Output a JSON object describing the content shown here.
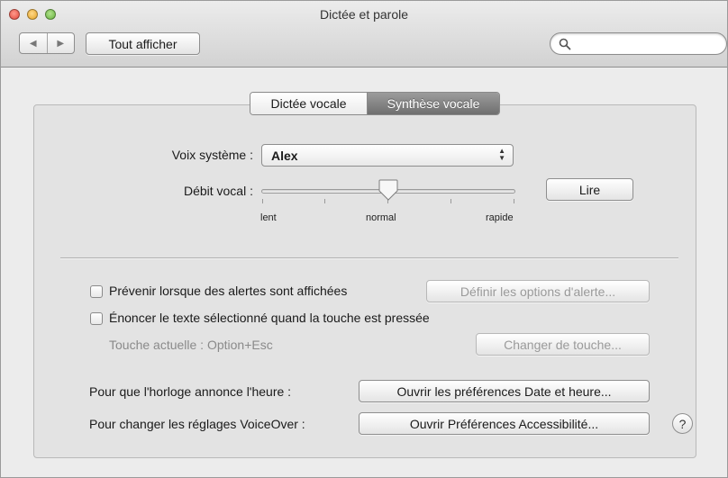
{
  "window": {
    "title": "Dictée et parole"
  },
  "toolbar": {
    "back_icon": "◀",
    "forward_icon": "▶",
    "show_all_label": "Tout afficher",
    "search_placeholder": ""
  },
  "tabs": [
    {
      "label": "Dictée vocale",
      "active": false
    },
    {
      "label": "Synthèse vocale",
      "active": true
    }
  ],
  "voice": {
    "label": "Voix système :",
    "selected": "Alex"
  },
  "rate": {
    "label": "Débit vocal :",
    "value_fraction": 0.5,
    "min_label": "lent",
    "mid_label": "normal",
    "max_label": "rapide",
    "play_label": "Lire"
  },
  "alerts": {
    "checkbox_label": "Prévenir lorsque des alertes sont affichées",
    "checked": false,
    "options_label": "Définir les options d'alerte..."
  },
  "speak_selection": {
    "checkbox_label": "Énoncer le texte sélectionné quand la touche est pressée",
    "checked": false,
    "current_key": "Touche actuelle : Option+Esc",
    "change_key_label": "Changer de touche..."
  },
  "clock": {
    "label": "Pour que l'horloge annonce l'heure :",
    "button_label": "Ouvrir les préférences Date et heure..."
  },
  "voiceover": {
    "label": "Pour changer les réglages VoiceOver :",
    "button_label": "Ouvrir Préférences Accessibilité..."
  },
  "help": {
    "label": "?"
  },
  "colors": {
    "active_tab": "#7f7f7f",
    "window_bg": "#ececec"
  }
}
